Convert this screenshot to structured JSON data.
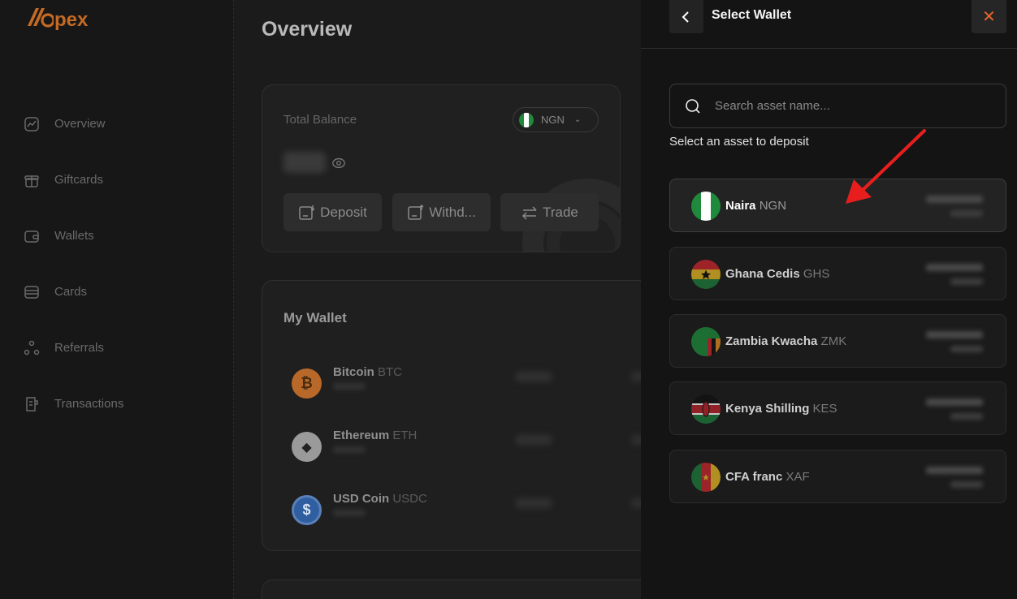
{
  "brand": {
    "logo_text": "pex",
    "accent": "#c46a24"
  },
  "sidebar": {
    "items": [
      {
        "label": "Overview",
        "icon": "chart-icon"
      },
      {
        "label": "Giftcards",
        "icon": "gift-icon"
      },
      {
        "label": "Wallets",
        "icon": "wallet-icon"
      },
      {
        "label": "Cards",
        "icon": "card-icon"
      },
      {
        "label": "Referrals",
        "icon": "referrals-icon"
      },
      {
        "label": "Transactions",
        "icon": "receipt-icon"
      }
    ]
  },
  "main": {
    "title": "Overview",
    "balance": {
      "label": "Total Balance",
      "currency": "NGN",
      "actions": [
        {
          "label": "Deposit",
          "icon": "deposit-icon"
        },
        {
          "label": "Withd...",
          "icon": "withdraw-icon"
        },
        {
          "label": "Trade",
          "icon": "trade-icon"
        }
      ]
    },
    "wallet": {
      "title": "My Wallet",
      "coins": [
        {
          "name": "Bitcoin",
          "ticker": "BTC",
          "color": "#b8692a",
          "glyph": "₿"
        },
        {
          "name": "Ethereum",
          "ticker": "ETH",
          "color": "#9a9a9a",
          "glyph": "◆"
        },
        {
          "name": "USD Coin",
          "ticker": "USDC",
          "color": "#2f5fa0",
          "glyph": "$"
        }
      ]
    }
  },
  "panel": {
    "title": "Select Wallet",
    "search_placeholder": "Search asset name...",
    "helper": "Select an asset to deposit",
    "assets": [
      {
        "name": "Naira",
        "ticker": "NGN",
        "flag": "ng"
      },
      {
        "name": "Ghana Cedis",
        "ticker": "GHS",
        "flag": "gh"
      },
      {
        "name": "Zambia Kwacha",
        "ticker": "ZMK",
        "flag": "zm"
      },
      {
        "name": "Kenya Shilling",
        "ticker": "KES",
        "flag": "ke"
      },
      {
        "name": "CFA franc",
        "ticker": "XAF",
        "flag": "cm"
      }
    ]
  },
  "colors": {
    "close": "#e8632a",
    "annotation_arrow": "#e81e1e"
  }
}
